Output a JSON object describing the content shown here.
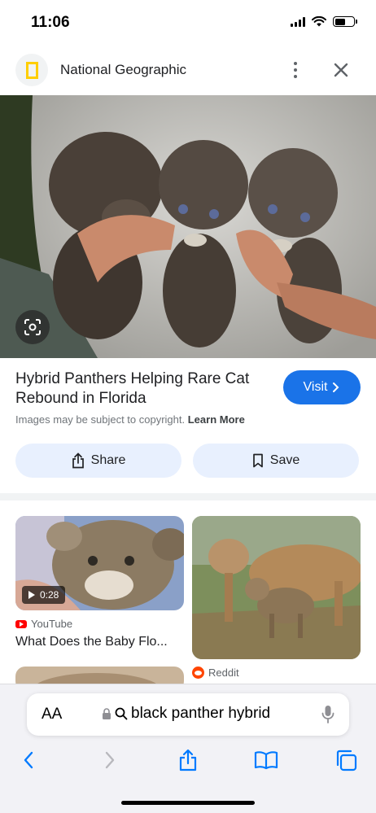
{
  "status": {
    "time": "11:06"
  },
  "header": {
    "site_name": "National Geographic"
  },
  "result": {
    "title": "Hybrid Panthers Helping Rare Cat Rebound in Florida",
    "visit_label": "Visit",
    "copyright_text": "Images may be subject to copyright.",
    "learn_more": "Learn More",
    "share_label": "Share",
    "save_label": "Save"
  },
  "related": [
    {
      "duration": "0:28",
      "source": "YouTube",
      "title": "What Does the Baby Flo..."
    },
    {
      "source": "Reddit"
    }
  ],
  "browser": {
    "aa_label": "AA",
    "address_text": "black panther hybrid"
  },
  "colors": {
    "accent": "#1a73e8",
    "tonal_button": "#e8f0fe"
  }
}
